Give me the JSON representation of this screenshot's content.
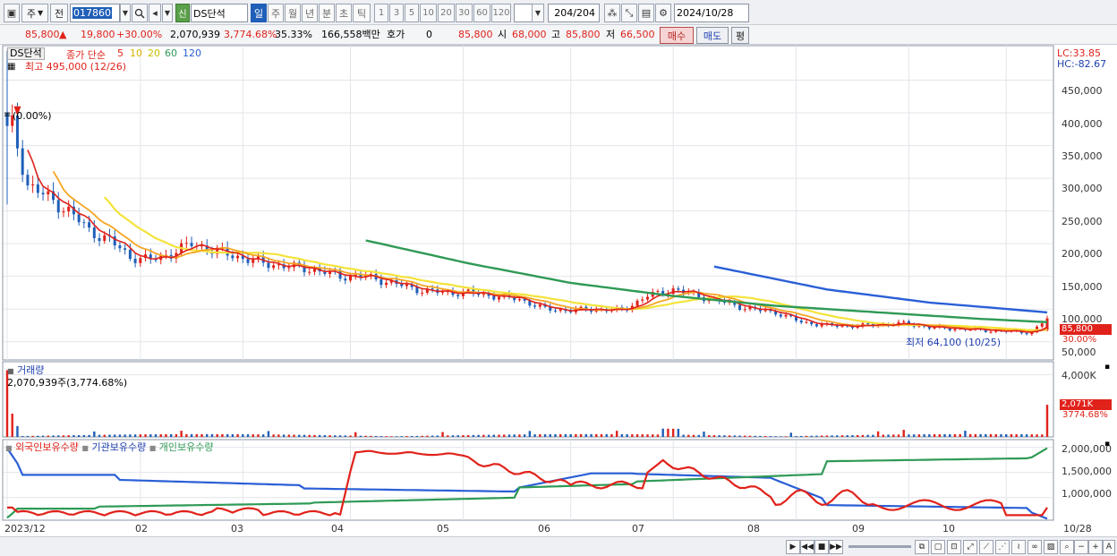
{
  "toolbar": {
    "period_type": "주",
    "prev_label": "전",
    "stock_code": "017860",
    "stock_name": "DS단석",
    "new_badge": "신",
    "periods": [
      "일",
      "주",
      "월",
      "년",
      "분",
      "초",
      "틱"
    ],
    "active_period": "일",
    "intervals": [
      "1",
      "3",
      "5",
      "10",
      "20",
      "30",
      "60",
      "120"
    ],
    "count_display": "204",
    "count_total": "/204",
    "date": "2024/10/28"
  },
  "infobar": {
    "price": "85,800",
    "change_arrow": "▲",
    "change": "19,800",
    "change_pct": "+30.00%",
    "volume": "2,070,939",
    "volume_ratio": "3,774.68%",
    "turnover": "35.33%",
    "amount": "166,558백만",
    "quote_label": "호가",
    "quote_value": "0",
    "quote_price": "85,800",
    "open_label": "시",
    "open": "68,000",
    "high_label": "고",
    "high": "85,800",
    "low_label": "저",
    "low": "66,500",
    "buy_button": "매수",
    "sell_button": "매도",
    "eval_button": "평"
  },
  "price_panel": {
    "legend_name": "DS단석",
    "legend_close": "종가 단순",
    "ma_labels": [
      "5",
      "10",
      "20",
      "60",
      "120"
    ],
    "high_note": "최고 495,000 (12/26)",
    "low_note": "최저 64,100 (10/25)",
    "pct_note": "(0.00%)",
    "lc": "LC:33.85",
    "hc": "HC:-82.67",
    "y_ticks": [
      "450,000",
      "400,000",
      "350,000",
      "300,000",
      "250,000",
      "200,000",
      "150,000",
      "100,000",
      "50,000"
    ],
    "price_tag": "85,800",
    "pct_tag": "30.00%"
  },
  "volume_panel": {
    "title": "거래량",
    "note": "2,070,939주(3,774.68%)",
    "y_tick": "4,000K",
    "vol_tag": "2,071K",
    "pct_tag": "3774.68%"
  },
  "holding_panel": {
    "legend_foreign": "외국인보유수량",
    "legend_inst": "기관보유수량",
    "legend_indiv": "개인보유수량",
    "y_ticks": [
      "2,000,000",
      "1,500,000",
      "1,000,000"
    ]
  },
  "x_axis": {
    "labels": [
      "2023/12",
      "02",
      "03",
      "04",
      "05",
      "06",
      "07",
      "08",
      "09",
      "10"
    ],
    "current_date": "10/28"
  },
  "chart_data": [
    {
      "type": "candlestick",
      "title": "DS단석",
      "ylim": [
        0,
        500000
      ],
      "y_ticks": [
        50000,
        100000,
        150000,
        200000,
        250000,
        300000,
        350000,
        400000,
        450000
      ],
      "close_approx": [
        [
          1,
          380000
        ],
        [
          4,
          290000
        ],
        [
          8,
          270000
        ],
        [
          12,
          250000
        ],
        [
          16,
          220000
        ],
        [
          20,
          205000
        ],
        [
          24,
          180000
        ],
        [
          28,
          175000
        ],
        [
          32,
          185000
        ],
        [
          36,
          200000
        ],
        [
          40,
          190000
        ],
        [
          45,
          180000
        ],
        [
          50,
          170000
        ],
        [
          55,
          165000
        ],
        [
          60,
          160000
        ],
        [
          65,
          150000
        ],
        [
          70,
          150000
        ],
        [
          75,
          140000
        ],
        [
          80,
          130000
        ],
        [
          85,
          125000
        ],
        [
          90,
          125000
        ],
        [
          95,
          120000
        ],
        [
          100,
          115000
        ],
        [
          105,
          100000
        ],
        [
          110,
          98000
        ],
        [
          115,
          100000
        ],
        [
          120,
          98000
        ],
        [
          125,
          120000
        ],
        [
          130,
          130000
        ],
        [
          135,
          120000
        ],
        [
          140,
          110000
        ],
        [
          145,
          100000
        ],
        [
          150,
          95000
        ],
        [
          155,
          80000
        ],
        [
          160,
          75000
        ],
        [
          165,
          74000
        ],
        [
          170,
          76000
        ],
        [
          175,
          78000
        ],
        [
          180,
          72000
        ],
        [
          185,
          70000
        ],
        [
          190,
          68000
        ],
        [
          195,
          66000
        ],
        [
          200,
          64100
        ],
        [
          203,
          85800
        ]
      ],
      "ma120": [
        [
          138,
          165000
        ],
        [
          160,
          130000
        ],
        [
          180,
          110000
        ],
        [
          203,
          95000
        ]
      ],
      "ma60": [
        [
          70,
          205000
        ],
        [
          90,
          170000
        ],
        [
          110,
          140000
        ],
        [
          130,
          120000
        ],
        [
          150,
          105000
        ],
        [
          170,
          95000
        ],
        [
          190,
          85000
        ],
        [
          203,
          80000
        ]
      ]
    },
    {
      "type": "bar",
      "title": "거래량",
      "ylim": [
        0,
        4500
      ],
      "y_tick": 4000,
      "unit": "K",
      "last_value": 2071
    },
    {
      "type": "line",
      "title": "",
      "series": [
        {
          "name": "외국인보유수량",
          "color": "#e0221b"
        },
        {
          "name": "기관보유수량",
          "color": "#2a5fd6"
        },
        {
          "name": "개인보유수량",
          "color": "#2f9a55"
        }
      ],
      "y_ticks": [
        1000000,
        1500000,
        2000000
      ]
    }
  ],
  "colors": {
    "up": "#e0221b",
    "down": "#1f5fb8",
    "ma5": "#e0221b",
    "ma10": "#f5a623",
    "ma20": "#f3e33a",
    "ma60": "#2f9a55",
    "ma120": "#2a5fd6"
  }
}
